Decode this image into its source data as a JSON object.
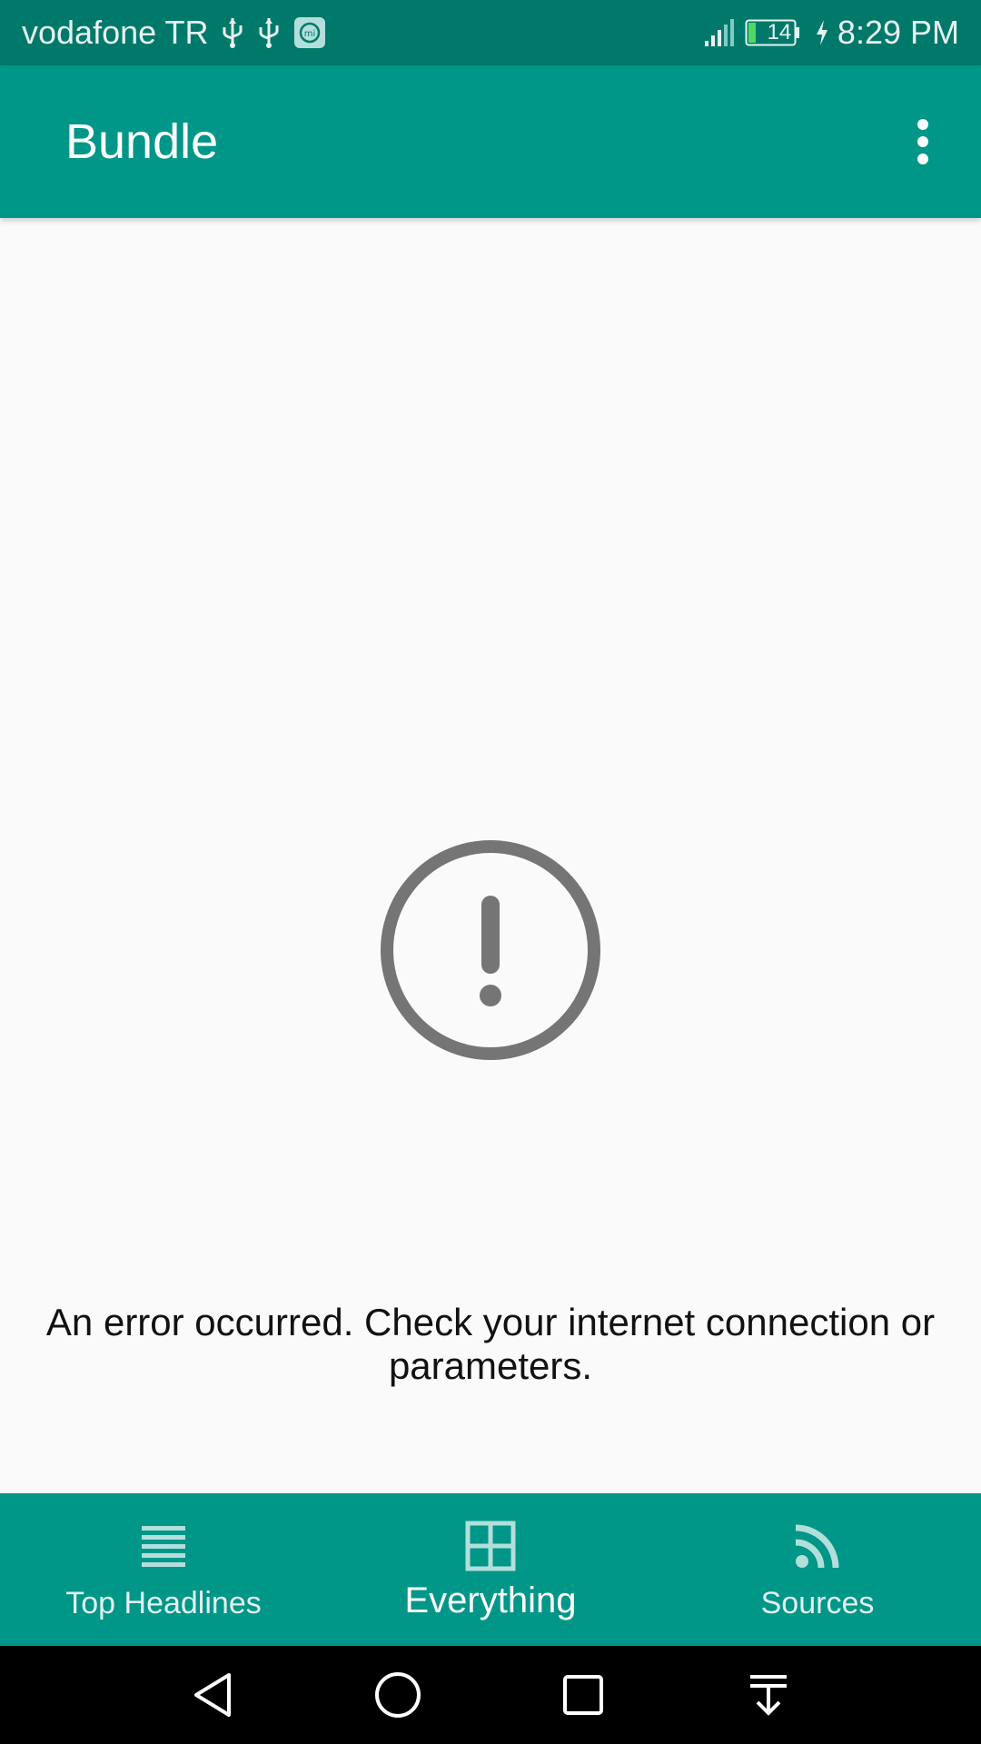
{
  "status_bar": {
    "carrier": "vodafone TR",
    "battery_level": "14",
    "time": "8:29 PM"
  },
  "app_bar": {
    "title": "Bundle"
  },
  "error": {
    "message": "An error occurred. Check your internet connection or parameters."
  },
  "bottom_nav": {
    "items": [
      {
        "label": "Top Headlines",
        "icon": "list-icon",
        "active": false
      },
      {
        "label": "Everything",
        "icon": "grid-icon",
        "active": true
      },
      {
        "label": "Sources",
        "icon": "rss-icon",
        "active": false
      }
    ]
  },
  "colors": {
    "status_bar": "#00796b",
    "primary": "#009688",
    "background": "#fafafa",
    "error_icon": "#757575"
  }
}
